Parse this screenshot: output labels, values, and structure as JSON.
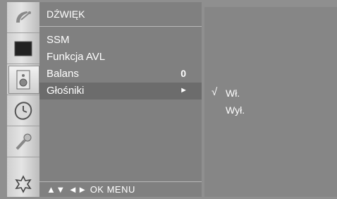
{
  "menu": {
    "title": "DŹWIĘK",
    "items": [
      {
        "label": "SSM",
        "value": ""
      },
      {
        "label": "Funkcja AVL",
        "value": ""
      },
      {
        "label": "Balans",
        "value": "0"
      },
      {
        "label": "Głośniki",
        "value": ""
      }
    ],
    "selected_arrow": "►",
    "bottom_bar": "▲▼ ◄► OK MENU"
  },
  "submenu": {
    "check_mark": "√",
    "options": [
      "Wł.",
      "Wył."
    ],
    "selected_index": 0
  },
  "icons": [
    "satellite-dish-icon",
    "picture-icon",
    "sound-speaker-icon",
    "clock-icon",
    "key-icon",
    "settings-icon"
  ],
  "colors": {
    "panel": "#808080",
    "selected_row": "#6c6c6c",
    "text": "#ffffff"
  }
}
